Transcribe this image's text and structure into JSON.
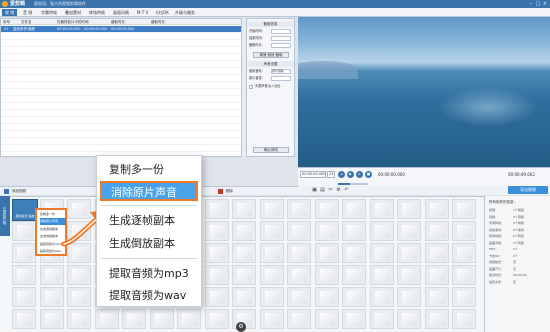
{
  "titlebar": {
    "app_name": "爱剪辑",
    "slogan": "超易用、强大的视频剪辑软件",
    "min": "–",
    "max": "□",
    "close": "×"
  },
  "nav": {
    "tabs": [
      "视 频",
      "音 频",
      "字幕特效",
      "叠加素材",
      "转场特效",
      "画面风格",
      "M T V",
      "卡拉OK",
      "升级与服务"
    ],
    "active_index": 0
  },
  "table": {
    "headers": [
      "序号",
      "文件名",
      "在最终影片中的时间",
      "截取时长",
      "截取时长"
    ],
    "rows": [
      {
        "index": "01",
        "name": "复制多份·缩放",
        "time": "00:00:00.000 - 00:00:00.000",
        "duration": "00:00:00.000",
        "selected": true
      }
    ],
    "empty_rows": 17
  },
  "props": {
    "header1": "截取信息",
    "start_label": "开始时间：",
    "end_label": "结束时间：",
    "duration_label": "截取时长：",
    "btn_speed": "调速·倒放·截取",
    "header2": "声音设置",
    "audio_label": "使用音轨：",
    "audio_value": "原片音轨",
    "volume_label": "原片音量：",
    "checkbox_label": "头尾声音淡入淡出",
    "confirm_label": "确认修改"
  },
  "player": {
    "time_in": "00:00:00.000",
    "speed_icon": "▶",
    "time_current": "00:00:00.000",
    "time_total": "00:00:49.662",
    "zoom": "2X"
  },
  "toolbar": {
    "add_video": "添加视频",
    "delete": "删除"
  },
  "export_button": "导出视频",
  "context_menu": {
    "items": [
      "复制多一份",
      "消除原片声音",
      "生成逐帧副本",
      "生成倒放副本",
      "提取音频为mp3",
      "提取音频为wav"
    ],
    "highlight_index": 1
  },
  "mini_menu": {
    "items": [
      "复制多一份",
      "消除原片声音",
      "生成逐帧副本",
      "生成倒放副本",
      "提取音频为mp3",
      "提取音频为wav"
    ],
    "highlight_index": 1
  },
  "sidebar_tab": "已添加片段",
  "clip": {
    "label": "复制多份·缩放"
  },
  "info_panel": {
    "title": "所有制作的信息：",
    "rows": [
      {
        "label": "视频：",
        "value": "1个视频"
      },
      {
        "label": "音频：",
        "value": "0个音频"
      },
      {
        "label": "字幕特效：",
        "value": "0个特效"
      },
      {
        "label": "叠加素材：",
        "value": "0个素材"
      },
      {
        "label": "转场特效：",
        "value": "0个转场"
      },
      {
        "label": "画面风格：",
        "value": "0个风格"
      },
      {
        "label": "MTV：",
        "value": "0个"
      },
      {
        "label": "卡拉OK：",
        "value": "0个"
      },
      {
        "label": "视频格式：",
        "value": "无"
      },
      {
        "label": "画面尺寸：",
        "value": "无"
      },
      {
        "label": "输出时长：",
        "value": "00:00:49"
      },
      {
        "label": "最终文件：",
        "value": "无"
      }
    ]
  },
  "colors": {
    "accent_blue": "#3b73ad",
    "highlight_blue": "#4aa3e8",
    "callout_orange": "#f07a28"
  }
}
